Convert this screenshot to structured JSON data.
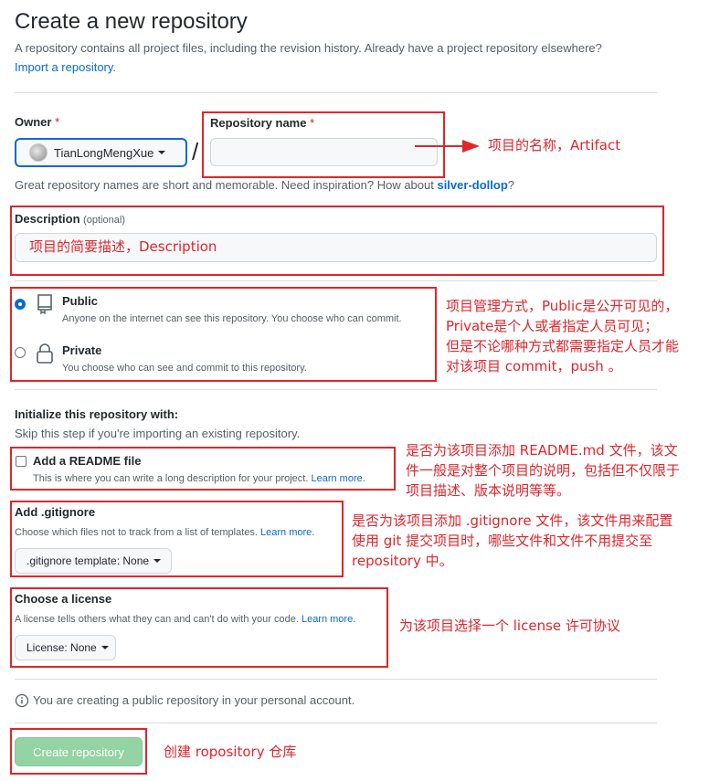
{
  "header": {
    "title": "Create a new repository",
    "subtitle": "A repository contains all project files, including the revision history. Already have a project repository elsewhere?",
    "import_link": "Import a repository",
    "import_period": "."
  },
  "owner": {
    "label": "Owner",
    "required_mark": "*",
    "value": "TianLongMengXue",
    "separator": "/"
  },
  "repo_name": {
    "label": "Repository name",
    "required_mark": "*",
    "value": ""
  },
  "name_hint": {
    "text": "Great repository names are short and memorable. Need inspiration? How about ",
    "suggestion": "silver-dollop",
    "end": "?"
  },
  "description": {
    "label": "Description",
    "optional": "(optional)",
    "value": "项目的简要描述，Description"
  },
  "visibility": {
    "public": {
      "label": "Public",
      "desc": "Anyone on the internet can see this repository. You choose who can commit.",
      "selected": true
    },
    "private": {
      "label": "Private",
      "desc": "You choose who can see and commit to this repository.",
      "selected": false
    }
  },
  "init": {
    "title": "Initialize this repository with:",
    "subtitle": "Skip this step if you're importing an existing repository.",
    "readme": {
      "label": "Add a README file",
      "desc": "This is where you can write a long description for your project.",
      "learn": "Learn more.",
      "checked": false
    },
    "gitignore": {
      "title": "Add .gitignore",
      "desc": "Choose which files not to track from a list of templates.",
      "learn": "Learn more.",
      "button": ".gitignore template: None"
    },
    "license": {
      "title": "Choose a license",
      "desc": "A license tells others what they can and can't do with your code.",
      "learn": "Learn more.",
      "button": "License: None"
    }
  },
  "notice": "You are creating a public repository in your personal account.",
  "submit": "Create repository",
  "annotations": {
    "name": "项目的名称，Artifact",
    "visibility": [
      "项目管理方式，Public是公开可见的，",
      "Private是个人或者指定人员可见；",
      "但是不论哪种方式都需要指定人员才能",
      "对该项目 commit，push 。"
    ],
    "readme": [
      "是否为该项目添加 README.md 文件，该文",
      "件一般是对整个项目的说明，包括但不仅限于",
      "项目描述、版本说明等等。"
    ],
    "gitignore": [
      "是否为该项目添加 .gitignore 文件，该文件用来配置",
      "使用 git 提交项目时，哪些文件和文件不用提交至",
      "repository 中。"
    ],
    "license": "为该项目选择一个 license 许可协议",
    "create": "创建 ropository 仓库"
  },
  "colors": {
    "annotation_red": "#e0262c",
    "link_blue": "#0969da",
    "radio_blue": "#0969da",
    "submit_green_disabled": "#94d3a2"
  }
}
